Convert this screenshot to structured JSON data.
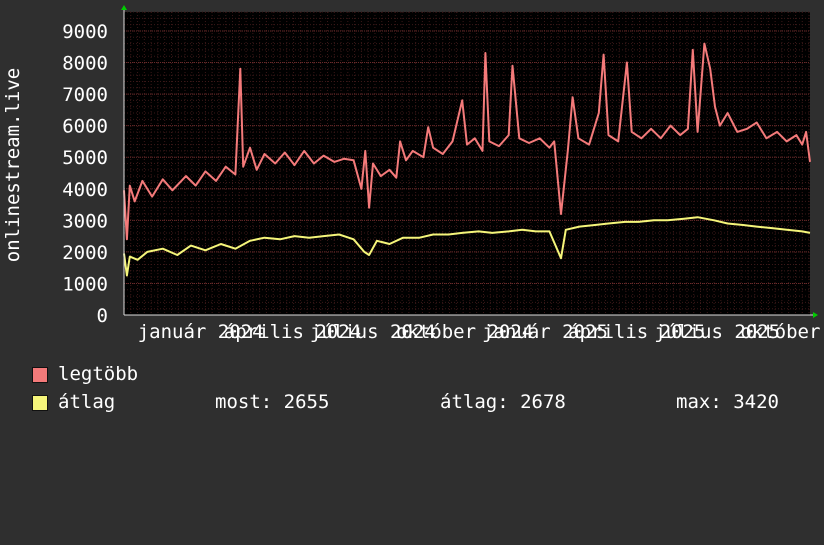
{
  "chart_data": {
    "type": "line",
    "ylabel": "onlinestream.live",
    "yticks": [
      0,
      1000,
      2000,
      3000,
      4000,
      5000,
      6000,
      7000,
      8000,
      9000
    ],
    "ylim": [
      0,
      9600
    ],
    "xticks": [
      "január 2024",
      "április 2024",
      "július 2024",
      "október 2024",
      "január 2025",
      "április 2025",
      "július 2025",
      "október 2025"
    ],
    "xlim": [
      "2024-01-01",
      "2025-12-09"
    ],
    "grid": true,
    "series": [
      {
        "name": "legtöbb",
        "color": "#f47a7a",
        "points": [
          [
            "2024-01-01",
            3950
          ],
          [
            "2024-01-04",
            2400
          ],
          [
            "2024-01-07",
            4100
          ],
          [
            "2024-01-12",
            3600
          ],
          [
            "2024-01-20",
            4250
          ],
          [
            "2024-01-30",
            3750
          ],
          [
            "2024-02-10",
            4300
          ],
          [
            "2024-02-20",
            3950
          ],
          [
            "2024-03-05",
            4400
          ],
          [
            "2024-03-15",
            4100
          ],
          [
            "2024-03-25",
            4550
          ],
          [
            "2024-04-05",
            4250
          ],
          [
            "2024-04-15",
            4700
          ],
          [
            "2024-04-25",
            4450
          ],
          [
            "2024-04-30",
            7800
          ],
          [
            "2024-05-03",
            4700
          ],
          [
            "2024-05-10",
            5300
          ],
          [
            "2024-05-17",
            4600
          ],
          [
            "2024-05-25",
            5100
          ],
          [
            "2024-06-05",
            4800
          ],
          [
            "2024-06-15",
            5150
          ],
          [
            "2024-06-25",
            4750
          ],
          [
            "2024-07-05",
            5200
          ],
          [
            "2024-07-15",
            4800
          ],
          [
            "2024-07-25",
            5050
          ],
          [
            "2024-08-05",
            4850
          ],
          [
            "2024-08-15",
            4950
          ],
          [
            "2024-08-25",
            4900
          ],
          [
            "2024-09-02",
            4000
          ],
          [
            "2024-09-06",
            5200
          ],
          [
            "2024-09-10",
            3400
          ],
          [
            "2024-09-14",
            4800
          ],
          [
            "2024-09-22",
            4400
          ],
          [
            "2024-10-01",
            4600
          ],
          [
            "2024-10-08",
            4350
          ],
          [
            "2024-10-12",
            5500
          ],
          [
            "2024-10-18",
            4900
          ],
          [
            "2024-10-25",
            5200
          ],
          [
            "2024-11-05",
            5000
          ],
          [
            "2024-11-10",
            5950
          ],
          [
            "2024-11-15",
            5300
          ],
          [
            "2024-11-25",
            5100
          ],
          [
            "2024-12-05",
            5500
          ],
          [
            "2024-12-15",
            6800
          ],
          [
            "2024-12-20",
            5400
          ],
          [
            "2024-12-28",
            5600
          ],
          [
            "2025-01-05",
            5200
          ],
          [
            "2025-01-08",
            8300
          ],
          [
            "2025-01-12",
            5500
          ],
          [
            "2025-01-22",
            5350
          ],
          [
            "2025-02-01",
            5700
          ],
          [
            "2025-02-05",
            7900
          ],
          [
            "2025-02-12",
            5600
          ],
          [
            "2025-02-22",
            5450
          ],
          [
            "2025-03-05",
            5600
          ],
          [
            "2025-03-15",
            5300
          ],
          [
            "2025-03-20",
            5500
          ],
          [
            "2025-03-27",
            3200
          ],
          [
            "2025-04-03",
            5200
          ],
          [
            "2025-04-08",
            6900
          ],
          [
            "2025-04-14",
            5600
          ],
          [
            "2025-04-25",
            5400
          ],
          [
            "2025-05-05",
            6400
          ],
          [
            "2025-05-10",
            8250
          ],
          [
            "2025-05-15",
            5700
          ],
          [
            "2025-05-25",
            5500
          ],
          [
            "2025-06-03",
            8000
          ],
          [
            "2025-06-08",
            5800
          ],
          [
            "2025-06-18",
            5600
          ],
          [
            "2025-06-28",
            5900
          ],
          [
            "2025-07-08",
            5600
          ],
          [
            "2025-07-18",
            6000
          ],
          [
            "2025-07-28",
            5700
          ],
          [
            "2025-08-05",
            5900
          ],
          [
            "2025-08-10",
            8400
          ],
          [
            "2025-08-15",
            5800
          ],
          [
            "2025-08-22",
            8600
          ],
          [
            "2025-08-28",
            7800
          ],
          [
            "2025-09-02",
            6600
          ],
          [
            "2025-09-07",
            6000
          ],
          [
            "2025-09-15",
            6400
          ],
          [
            "2025-09-25",
            5800
          ],
          [
            "2025-10-05",
            5900
          ],
          [
            "2025-10-15",
            6100
          ],
          [
            "2025-10-25",
            5600
          ],
          [
            "2025-11-05",
            5800
          ],
          [
            "2025-11-15",
            5500
          ],
          [
            "2025-11-25",
            5700
          ],
          [
            "2025-12-01",
            5400
          ],
          [
            "2025-12-05",
            5800
          ],
          [
            "2025-12-09",
            4850
          ]
        ]
      },
      {
        "name": "átlag",
        "color": "#f5f57a",
        "points": [
          [
            "2024-01-01",
            1950
          ],
          [
            "2024-01-04",
            1250
          ],
          [
            "2024-01-07",
            1850
          ],
          [
            "2024-01-15",
            1750
          ],
          [
            "2024-01-25",
            2000
          ],
          [
            "2024-02-10",
            2100
          ],
          [
            "2024-02-25",
            1900
          ],
          [
            "2024-03-10",
            2200
          ],
          [
            "2024-03-25",
            2050
          ],
          [
            "2024-04-10",
            2250
          ],
          [
            "2024-04-25",
            2100
          ],
          [
            "2024-05-10",
            2350
          ],
          [
            "2024-05-25",
            2450
          ],
          [
            "2024-06-10",
            2400
          ],
          [
            "2024-06-25",
            2500
          ],
          [
            "2024-07-10",
            2450
          ],
          [
            "2024-07-25",
            2500
          ],
          [
            "2024-08-10",
            2550
          ],
          [
            "2024-08-25",
            2400
          ],
          [
            "2024-09-05",
            2000
          ],
          [
            "2024-09-10",
            1900
          ],
          [
            "2024-09-18",
            2350
          ],
          [
            "2024-10-01",
            2250
          ],
          [
            "2024-10-15",
            2450
          ],
          [
            "2024-11-01",
            2450
          ],
          [
            "2024-11-15",
            2550
          ],
          [
            "2024-12-01",
            2550
          ],
          [
            "2024-12-15",
            2600
          ],
          [
            "2025-01-01",
            2650
          ],
          [
            "2025-01-15",
            2600
          ],
          [
            "2025-02-01",
            2650
          ],
          [
            "2025-02-15",
            2700
          ],
          [
            "2025-03-01",
            2650
          ],
          [
            "2025-03-15",
            2650
          ],
          [
            "2025-03-27",
            1800
          ],
          [
            "2025-04-01",
            2700
          ],
          [
            "2025-04-15",
            2800
          ],
          [
            "2025-05-01",
            2850
          ],
          [
            "2025-05-15",
            2900
          ],
          [
            "2025-06-01",
            2950
          ],
          [
            "2025-06-15",
            2950
          ],
          [
            "2025-07-01",
            3000
          ],
          [
            "2025-07-15",
            3000
          ],
          [
            "2025-08-01",
            3050
          ],
          [
            "2025-08-15",
            3100
          ],
          [
            "2025-09-01",
            3000
          ],
          [
            "2025-09-15",
            2900
          ],
          [
            "2025-10-01",
            2850
          ],
          [
            "2025-10-15",
            2800
          ],
          [
            "2025-11-01",
            2750
          ],
          [
            "2025-11-15",
            2700
          ],
          [
            "2025-12-01",
            2650
          ],
          [
            "2025-12-09",
            2600
          ]
        ]
      }
    ]
  },
  "legend": {
    "items": [
      {
        "label": "legtöbb",
        "color": "#f47a7a"
      },
      {
        "label": "átlag",
        "color": "#f5f57a"
      }
    ],
    "stats": {
      "now": "most: 2655",
      "avg": "átlag: 2678",
      "max": "max: 3420"
    }
  }
}
